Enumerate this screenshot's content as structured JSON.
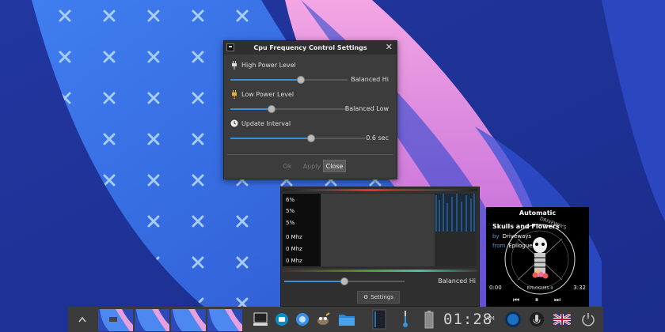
{
  "dialog": {
    "title": "Cpu Frequency Control Settings",
    "close_glyph": "✕",
    "high_power": {
      "label": "High Power Level",
      "value_text": "Balanced Hi",
      "level": 0.6
    },
    "low_power": {
      "label": "Low Power Level",
      "value_text": "Balanced Low",
      "level": 0.35
    },
    "update_interval": {
      "label": "Update Interval",
      "value_text": "0.6 sec",
      "level": 0.6
    },
    "buttons": {
      "ok": "Ok",
      "apply": "Apply",
      "close": "Close"
    }
  },
  "monitor": {
    "labels": [
      "6%",
      "5%",
      "5%",
      "0 Mhz",
      "0 Mhz",
      "0 Mhz"
    ],
    "power_value_text": "Balanced Hi",
    "power_level": 0.5,
    "settings_label": "Settings"
  },
  "media": {
    "title": "Automatic",
    "track": "Skulls and Flowers",
    "by_label": "by",
    "artist": "Driveways",
    "from_label": "from",
    "album": "Epilogues",
    "time_elapsed": "0:00",
    "time_total": "3:32",
    "art_text": "DRIVEWAYS",
    "art_subtext": "EPILOGUES II"
  },
  "taskbar": {
    "clock": "01:28",
    "ampm": "AM",
    "icons": [
      "up-arrow-icon",
      "desktop-thumbnail",
      "terminal-icon",
      "messenger-icon",
      "browser-icon",
      "gimp-icon",
      "folder-icon",
      "cpu-monitor-icon",
      "thermometer-icon",
      "battery-icon",
      "moon-icon",
      "microphone-icon",
      "uk-flag-icon",
      "power-icon"
    ]
  },
  "colors": {
    "accent": "#3d8fd8",
    "dialog_bg": "#3c3c3c",
    "taskbar_bg": "#3b3b3b"
  }
}
